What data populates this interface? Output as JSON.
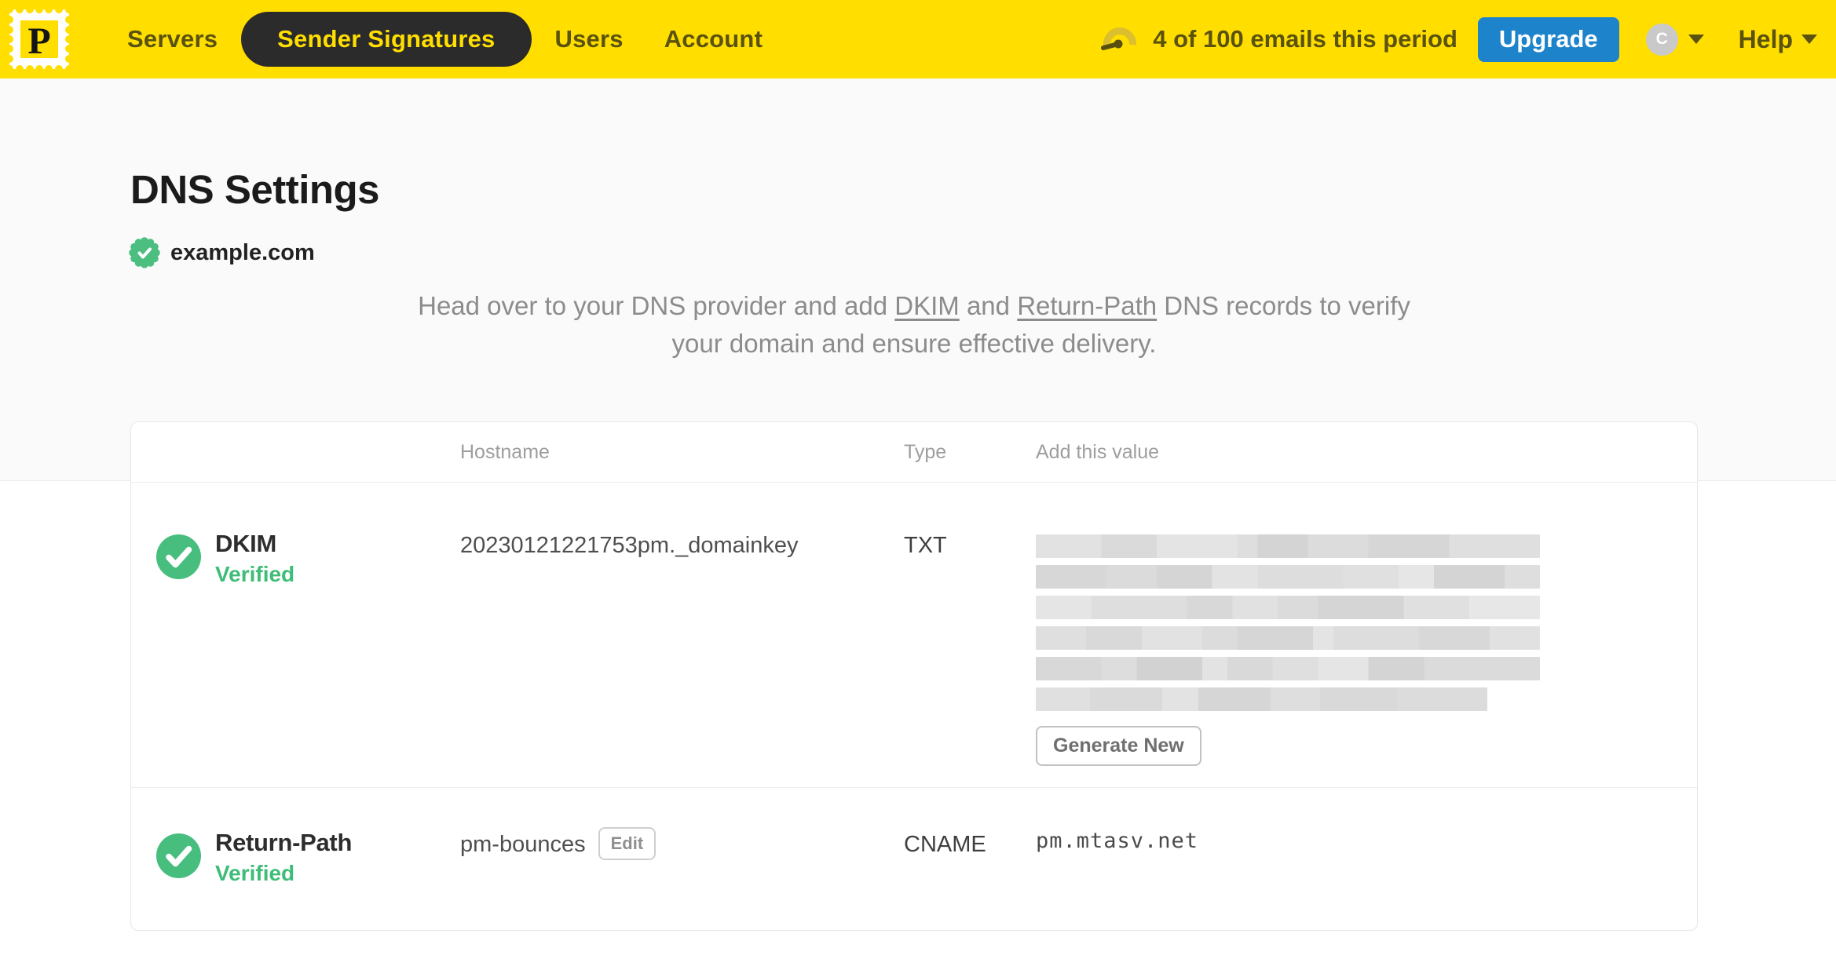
{
  "nav": {
    "logo_letter": "P",
    "items": [
      {
        "label": "Servers",
        "active": false
      },
      {
        "label": "Sender Signatures",
        "active": true
      },
      {
        "label": "Users",
        "active": false
      },
      {
        "label": "Account",
        "active": false
      }
    ],
    "usage_text": "4 of 100 emails this period",
    "upgrade_label": "Upgrade",
    "avatar_initial": "C",
    "help_label": "Help"
  },
  "page": {
    "title": "DNS Settings",
    "domain": "example.com",
    "description": {
      "part1": "Head over to your DNS provider and add ",
      "link_dkim": "DKIM",
      "part2": " and ",
      "link_return_path": "Return-Path",
      "part3": " DNS records to verify your domain and ensure effective delivery."
    }
  },
  "table": {
    "headers": {
      "hostname": "Hostname",
      "type": "Type",
      "value": "Add this value"
    },
    "rows": [
      {
        "name": "DKIM",
        "status": "Verified",
        "hostname": "20230121221753pm._domainkey",
        "type": "TXT",
        "value_redacted": true,
        "action_label": "Generate New"
      },
      {
        "name": "Return-Path",
        "status": "Verified",
        "hostname": "pm-bounces",
        "edit_label": "Edit",
        "type": "CNAME",
        "value": "pm.mtasv.net"
      }
    ]
  },
  "colors": {
    "brand_yellow": "#FFDE00",
    "nav_text": "#5A520F",
    "active_pill_bg": "#2B2B2B",
    "upgrade_blue": "#1D83CB",
    "verified_green": "#3EBD77",
    "check_circle_green": "#47BE7E",
    "seal_green": "#4CBE80"
  }
}
